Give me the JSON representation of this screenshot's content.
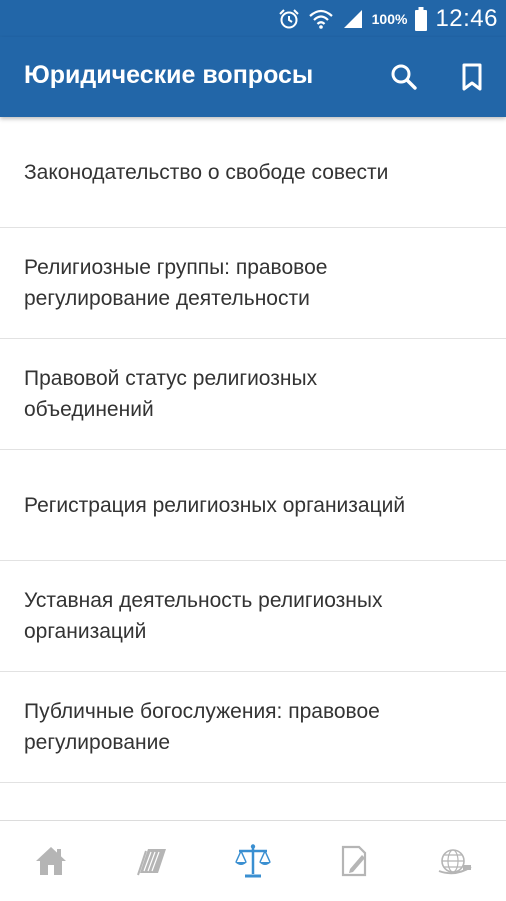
{
  "status_bar": {
    "battery_percent": "100%",
    "time": "12:46",
    "icons": [
      "alarm-icon",
      "wifi-icon",
      "signal-icon",
      "battery-icon"
    ]
  },
  "app_bar": {
    "title": "Юридические вопросы",
    "actions": [
      "search-icon",
      "bookmark-icon"
    ]
  },
  "list": {
    "items": [
      {
        "label": "Законодательство о свободе совести"
      },
      {
        "label": "Религиозные группы: правовое\nрегулирование деятельности"
      },
      {
        "label": "Правовой статус религиозных\nобъединений"
      },
      {
        "label": "Регистрация религиозных организаций"
      },
      {
        "label": "Уставная деятельность религиозных\nорганизаций"
      },
      {
        "label": "Публичные богослужения: правовое\nрегулирование"
      }
    ]
  },
  "bottom_nav": {
    "items": [
      {
        "icon": "home-icon",
        "active": false
      },
      {
        "icon": "books-icon",
        "active": false
      },
      {
        "icon": "scales-icon",
        "active": true
      },
      {
        "icon": "document-edit-icon",
        "active": false
      },
      {
        "icon": "globe-logo-icon",
        "active": false
      }
    ]
  },
  "colors": {
    "primary": "#2266a8",
    "active_icon": "#3a8fd1",
    "inactive_icon": "#b5b5b5",
    "text": "#333333",
    "divider": "#e2e2e2"
  }
}
